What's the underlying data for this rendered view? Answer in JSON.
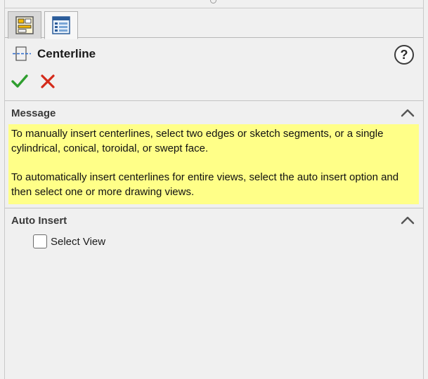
{
  "feature": {
    "title": "Centerline",
    "icon": "centerline-icon"
  },
  "tabs": [
    {
      "icon": "property-manager-icon",
      "active": false
    },
    {
      "icon": "config-list-icon",
      "active": true
    }
  ],
  "help": {
    "label": "?"
  },
  "actions": {
    "ok_icon": "green-checkmark-icon",
    "cancel_icon": "red-x-icon"
  },
  "groups": {
    "message": {
      "title": "Message",
      "paragraphs": [
        "To manually insert centerlines, select two edges or sketch segments, or a single cylindrical, conical, toroidal, or swept face.",
        "To automatically insert centerlines for entire views, select the auto insert option and then select one or more drawing views."
      ]
    },
    "auto_insert": {
      "title": "Auto Insert",
      "select_view_label": "Select View",
      "select_view_checked": false
    }
  },
  "colors": {
    "message_bg": "#ffff88",
    "ok": "#2e9e2e",
    "cancel": "#d42a1a"
  }
}
